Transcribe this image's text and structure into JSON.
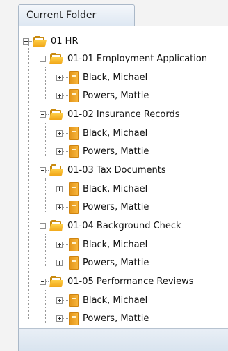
{
  "panel": {
    "tab_label": "Current Folder"
  },
  "tree": {
    "root": {
      "label": "01 HR",
      "children": [
        {
          "label": "01-01 Employment Application",
          "children": [
            "Black, Michael",
            "Powers, Mattie"
          ]
        },
        {
          "label": "01-02 Insurance Records",
          "children": [
            "Black, Michael",
            "Powers, Mattie"
          ]
        },
        {
          "label": "01-03 Tax Documents",
          "children": [
            "Black, Michael",
            "Powers, Mattie"
          ]
        },
        {
          "label": "01-04 Background Check",
          "children": [
            "Black, Michael",
            "Powers, Mattie"
          ]
        },
        {
          "label": "01-05 Performance Reviews",
          "children": [
            "Black, Michael",
            "Powers, Mattie"
          ]
        }
      ]
    }
  },
  "icons": {
    "folder": "open-folder-icon",
    "binder": "binder-icon",
    "expand": "plus-icon",
    "collapse": "minus-icon"
  },
  "colors": {
    "panel_bg": "#ffffff",
    "tab_border": "#aab8c8",
    "folder": "#f0a618",
    "binder": "#e3951a"
  }
}
